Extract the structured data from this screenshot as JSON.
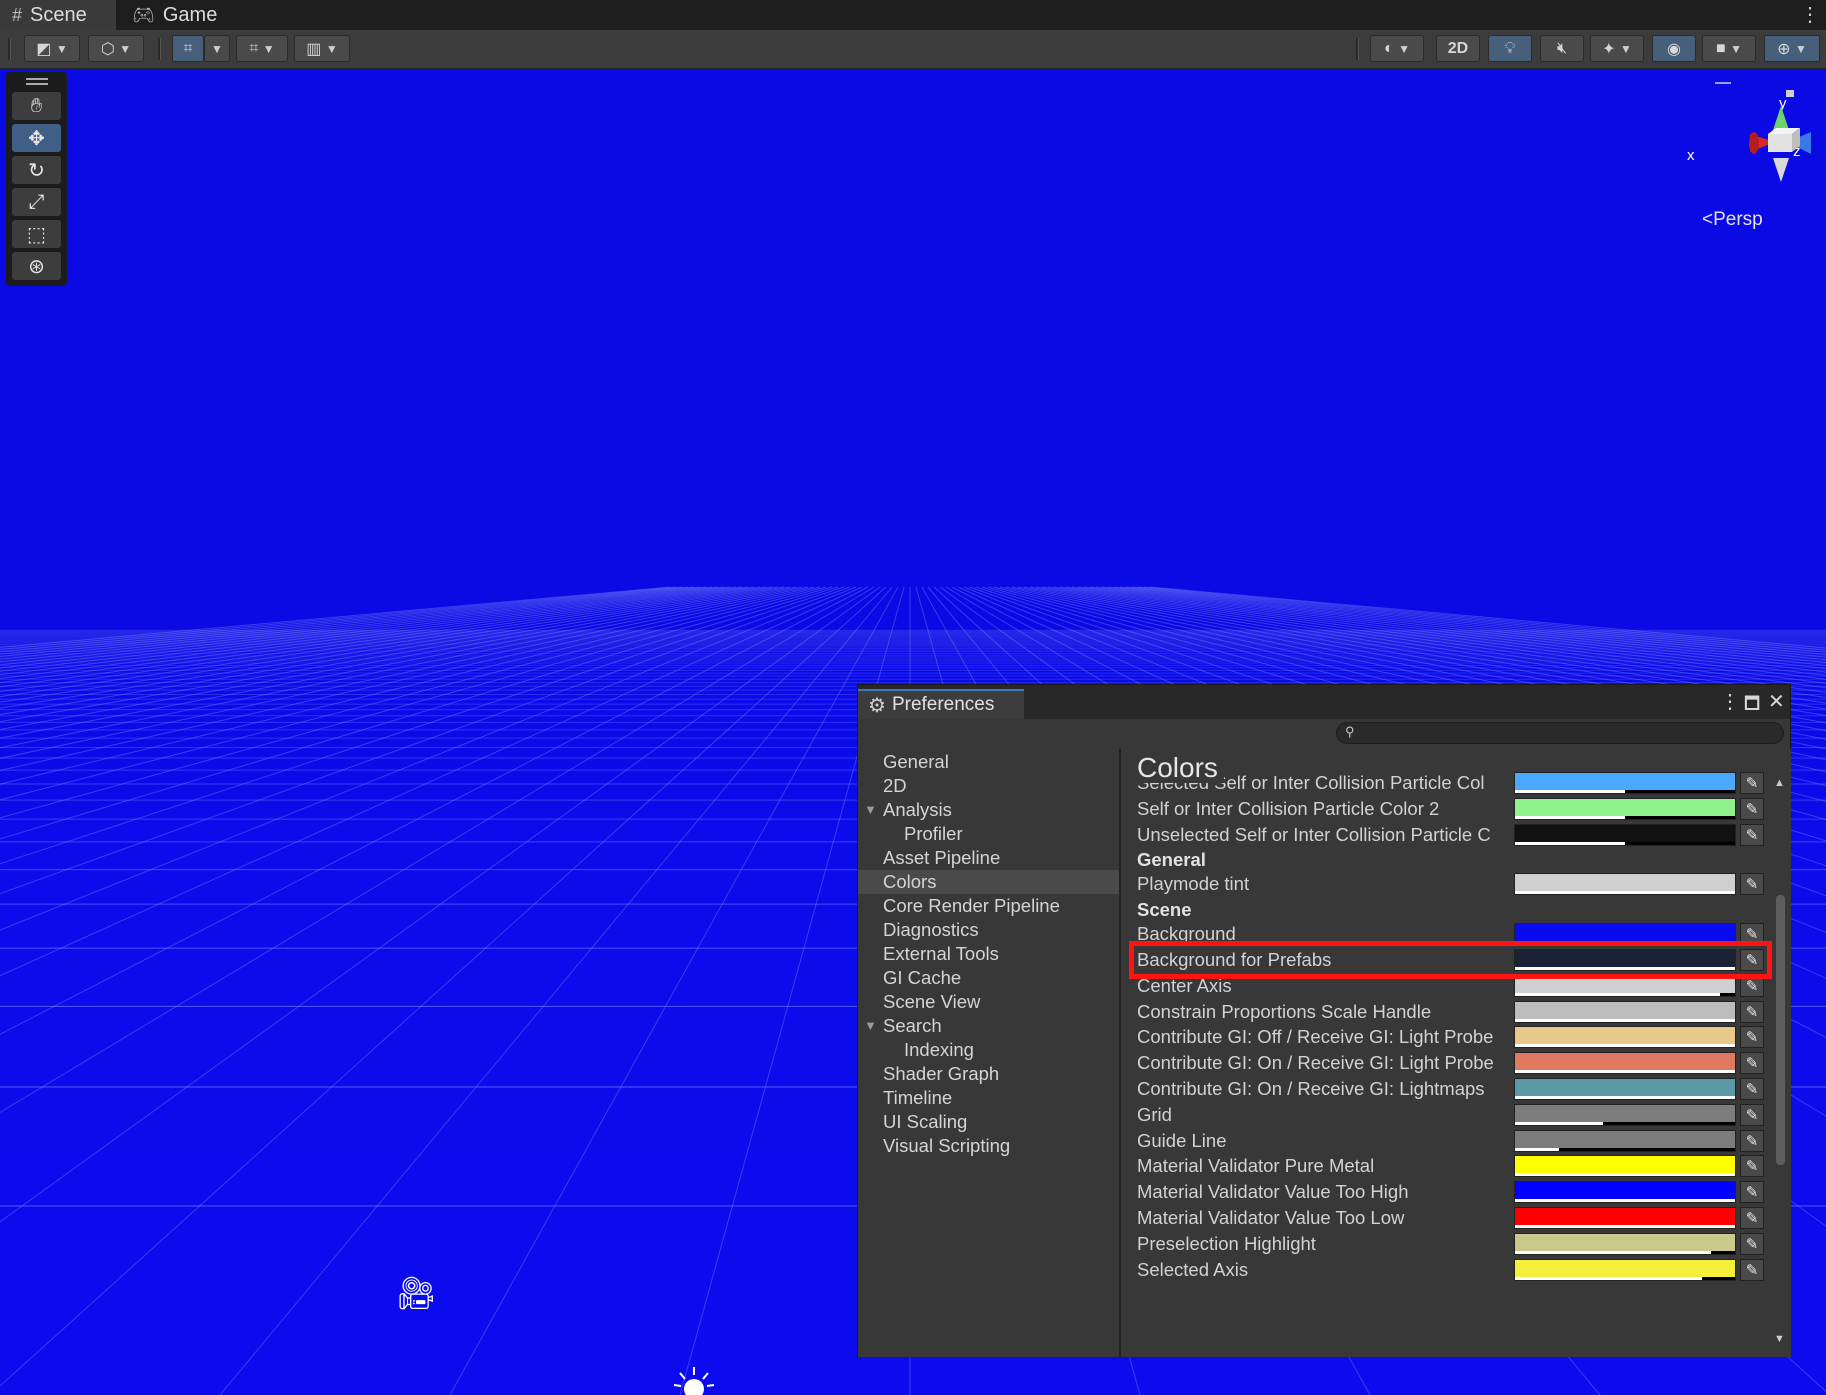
{
  "tabs": [
    {
      "label": "Scene",
      "icon": "hash-icon"
    },
    {
      "label": "Game",
      "icon": "gamepad-icon"
    }
  ],
  "toolbar": {
    "mode_2d_label": "2D"
  },
  "scene": {
    "camera_mode": "Persp",
    "axes": {
      "x": "x",
      "y": "y",
      "z": "z"
    }
  },
  "preferences": {
    "title": "Preferences",
    "search": {
      "placeholder": "",
      "value": ""
    },
    "sidebar": [
      {
        "label": "General",
        "indent": 0
      },
      {
        "label": "2D",
        "indent": 0
      },
      {
        "label": "Analysis",
        "indent": 0,
        "expanded": true
      },
      {
        "label": "Profiler",
        "indent": 1
      },
      {
        "label": "Asset Pipeline",
        "indent": 0
      },
      {
        "label": "Colors",
        "indent": 0,
        "selected": true
      },
      {
        "label": "Core Render Pipeline",
        "indent": 0
      },
      {
        "label": "Diagnostics",
        "indent": 0
      },
      {
        "label": "External Tools",
        "indent": 0
      },
      {
        "label": "GI Cache",
        "indent": 0
      },
      {
        "label": "Scene View",
        "indent": 0
      },
      {
        "label": "Search",
        "indent": 0,
        "expanded": true
      },
      {
        "label": "Indexing",
        "indent": 1
      },
      {
        "label": "Shader Graph",
        "indent": 0
      },
      {
        "label": "Timeline",
        "indent": 0
      },
      {
        "label": "UI Scaling",
        "indent": 0
      },
      {
        "label": "Visual Scripting",
        "indent": 0
      }
    ],
    "content": {
      "title": "Colors",
      "sections": [
        {
          "header": null,
          "rows": [
            {
              "label": "Selected Self or Inter Collision Particle Col",
              "color": "#4aa8ff",
              "alpha": 0.5
            },
            {
              "label": "Self or Inter Collision Particle Color 2",
              "color": "#8ff28a",
              "alpha": 0.5
            },
            {
              "label": "Unselected Self or Inter Collision Particle C",
              "color": "#111111",
              "alpha": 0.5
            }
          ]
        },
        {
          "header": "General",
          "rows": [
            {
              "label": "Playmode tint",
              "color": "#cfcfcf",
              "alpha": 1.0
            }
          ]
        },
        {
          "header": "Scene",
          "rows": [
            {
              "label": "Background",
              "color": "#0a0af0",
              "alpha": 1.0,
              "highlighted": true
            },
            {
              "label": "Background for Prefabs",
              "color": "#1b2236",
              "alpha": 1.0
            },
            {
              "label": "Center Axis",
              "color": "#d0d0d0",
              "alpha": 0.93
            },
            {
              "label": "Constrain Proportions Scale Handle",
              "color": "#bdbdbd",
              "alpha": 1.0
            },
            {
              "label": "Contribute GI: Off / Receive GI: Light Probe",
              "color": "#e9c98a",
              "alpha": 1.0
            },
            {
              "label": "Contribute GI: On / Receive GI: Light Probe",
              "color": "#df7a60",
              "alpha": 1.0
            },
            {
              "label": "Contribute GI: On / Receive GI: Lightmaps",
              "color": "#5a9aa6",
              "alpha": 1.0
            },
            {
              "label": "Grid",
              "color": "#7c7c7c",
              "alpha": 0.4
            },
            {
              "label": "Guide Line",
              "color": "#7c7c7c",
              "alpha": 0.2
            },
            {
              "label": "Material Validator Pure Metal",
              "color": "#ffff00",
              "alpha": 1.0
            },
            {
              "label": "Material Validator Value Too High",
              "color": "#0000ff",
              "alpha": 1.0
            },
            {
              "label": "Material Validator Value Too Low",
              "color": "#ff0000",
              "alpha": 1.0
            },
            {
              "label": "Preselection Highlight",
              "color": "#c9c98c",
              "alpha": 0.89
            },
            {
              "label": "Selected Axis",
              "color": "#f4f03a",
              "alpha": 0.85
            }
          ]
        }
      ]
    }
  }
}
